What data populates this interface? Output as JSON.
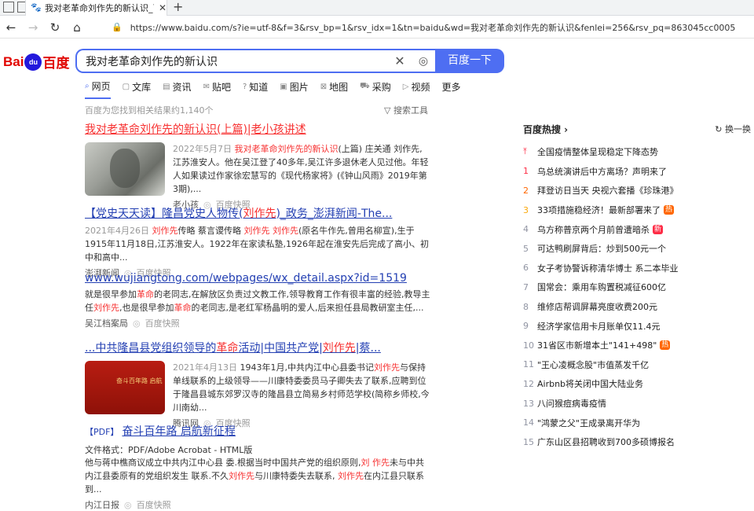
{
  "browser": {
    "tab_title": "我对老革命刘作先的新认识_百度",
    "url": "https://www.baidu.com/s?ie=utf-8&f=3&rsv_bp=1&rsv_idx=1&tn=baidu&wd=我对老革命刘作先的新认识&fenlei=256&rsv_pq=863045cc00059620&rsv_t=543bHN"
  },
  "header": {
    "logo_bai": "Bai",
    "logo_paw": "du",
    "logo_du": "百度",
    "query": "我对老革命刘作先的新认识",
    "search_button": "百度一下"
  },
  "categories": [
    {
      "icon": "search-icon",
      "label": "网页"
    },
    {
      "icon": "doc-icon",
      "label": "文库"
    },
    {
      "icon": "news-icon",
      "label": "资讯"
    },
    {
      "icon": "tieba-icon",
      "label": "贴吧"
    },
    {
      "icon": "zhidao-icon",
      "label": "知道"
    },
    {
      "icon": "image-icon",
      "label": "图片"
    },
    {
      "icon": "map-icon",
      "label": "地图"
    },
    {
      "icon": "cart-icon",
      "label": "采购"
    },
    {
      "icon": "video-icon",
      "label": "视频"
    },
    {
      "icon": "",
      "label": "更多"
    }
  ],
  "stats": "百度为您找到相关结果约1,140个",
  "tools_label": "搜索工具",
  "results": [
    {
      "title_pre": "我对老革命刘作先的新认识",
      "title_mid": "(上篇)|老小孩讲述",
      "date": "2022年5月7日",
      "snip_hl": "我对老革命刘作先的新认识",
      "snip_rest": "(上篇) 庄关通 刘作先,江苏淮安人。他在吴江登了40多年,吴江许多退休老人见过他。年轻人如果读过作家徐宏慧写的《现代杨家将》(《钟山风雨》2019年第3期),...",
      "source": "老小孩",
      "snapshot": "百度快照"
    },
    {
      "title_pre": "【党史天天读】隆昌党史人物传(",
      "title_hl": "刘作先",
      "title_post": ")_政务_澎湃新闻-The...",
      "date": "2021年4月26日",
      "snip_hl1": "刘作先",
      "snip_a": "传略 蔡言谡传略 ",
      "snip_hl2": "刘作先 刘作先",
      "snip_b": "(原名牛作先,曾用名柳宣),生于1915年11月18日,江苏淮安人。1922年在家读私塾,1926年起在淮安先后完成了高小、初中和高中...",
      "source": "澎湃新闻",
      "snapshot": "百度快照"
    },
    {
      "title": "www.wujiangtong.com/webpages/wx_detail.aspx?id=1519",
      "snip_a": "就是很早参加",
      "snip_hl1": "革命",
      "snip_b": "的老同志,在解放区负责过文教工作,领导教育工作有很丰富的经验,教导主任",
      "snip_hl2": "刘作先",
      "snip_c": ",也是很早参加",
      "snip_hl3": "革命",
      "snip_d": "的老同志,是老红军杨晶明的爱人,后来担任县局教研室主任,...",
      "source": "吴江档案局",
      "snapshot": "百度快照"
    },
    {
      "title_pre": "...中共隆昌县党组织领导的",
      "title_hl1": "革命",
      "title_mid": "活动|中国共产党|",
      "title_hl2": "刘作先",
      "title_post": "|蔡...",
      "date": "2021年4月13日",
      "snip_a": "1943年1月,中共内江中心县委书记",
      "snip_hl1": "刘作先",
      "snip_b": "与保持单线联系的上级领导——川康特委委员马子卿失去了联系,应聘到位于隆昌县城东郊罗汉寺的隆昌县立简易乡村师范学校(简称乡师校,今川南幼...",
      "poster_text": "奋斗百年路 启航",
      "source": "腾讯网",
      "snapshot": "百度快照"
    },
    {
      "tag": "【PDF】",
      "title": "奋斗百年路 启航新征程",
      "filetype": "文件格式：PDF/Adobe Acrobat - HTML版",
      "snip_a": "他与蒋中樵商议成立中共内江中心县 委.根据当时中国共产党的组织原则,",
      "snip_hl1": "刘 作先",
      "snip_b": "未与中共内江县委原有的党组织发生 联系.不久",
      "snip_hl2": "刘作先",
      "snip_c": "与川康特委失去联系, ",
      "snip_hl3": "刘作先",
      "snip_d": "在内江县只联系到...",
      "source": "内江日报",
      "snapshot": "百度快照"
    }
  ],
  "hot": {
    "title": "百度热搜 ›",
    "refresh": "换一换",
    "items": [
      {
        "rank": "⤒",
        "text": "全国疫情整体呈现稳定下降态势",
        "badge": ""
      },
      {
        "rank": "1",
        "text": "乌总统演讲后中方离场？声明来了",
        "badge": ""
      },
      {
        "rank": "2",
        "text": "拜登访日当天 央视六套播《珍珠港》",
        "badge": ""
      },
      {
        "rank": "3",
        "text": "33项措施稳经济！最新部署来了",
        "badge": "热"
      },
      {
        "rank": "4",
        "text": "乌方称普京两个月前曾遭暗杀",
        "badge": "新"
      },
      {
        "rank": "5",
        "text": "可达鸭刷屏背后：炒到500元一个",
        "badge": ""
      },
      {
        "rank": "6",
        "text": "女子考协警诉称清华博士 系二本毕业",
        "badge": ""
      },
      {
        "rank": "7",
        "text": "国常会：乘用车购置税减征600亿",
        "badge": ""
      },
      {
        "rank": "8",
        "text": "维修店帮调屏幕亮度收费200元",
        "badge": ""
      },
      {
        "rank": "9",
        "text": "经济学家信用卡月账单仅11.4元",
        "badge": ""
      },
      {
        "rank": "10",
        "text": "31省区市新增本土\"141+498\"",
        "badge": "热"
      },
      {
        "rank": "11",
        "text": "\"王心凌概念股\"市值蒸发千亿",
        "badge": ""
      },
      {
        "rank": "12",
        "text": "Airbnb将关闭中国大陆业务",
        "badge": ""
      },
      {
        "rank": "13",
        "text": "八问猴痘病毒疫情",
        "badge": ""
      },
      {
        "rank": "14",
        "text": "\"鸿蒙之父\"王成录离开华为",
        "badge": ""
      },
      {
        "rank": "15",
        "text": "广东山区县招聘收到700多硕博报名",
        "badge": ""
      }
    ]
  }
}
